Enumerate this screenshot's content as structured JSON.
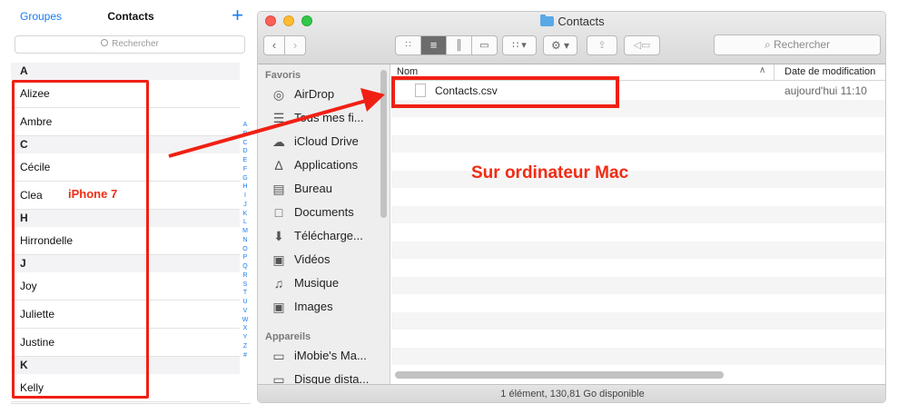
{
  "iphone": {
    "nav": {
      "left": "Groupes",
      "title": "Contacts",
      "add": "+"
    },
    "search_placeholder": "Rechercher",
    "rows": [
      {
        "kind": "hdr",
        "text": "A"
      },
      {
        "kind": "c",
        "text": "Alizee"
      },
      {
        "kind": "c",
        "text": "Ambre"
      },
      {
        "kind": "hdr",
        "text": "C"
      },
      {
        "kind": "c",
        "text": "Cécile"
      },
      {
        "kind": "c",
        "text": "Clea"
      },
      {
        "kind": "hdr",
        "text": "H"
      },
      {
        "kind": "c",
        "text": "Hirrondelle"
      },
      {
        "kind": "hdr",
        "text": "J"
      },
      {
        "kind": "c",
        "text": "Joy"
      },
      {
        "kind": "c",
        "text": "Juliette"
      },
      {
        "kind": "c",
        "text": "Justine"
      },
      {
        "kind": "hdr",
        "text": "K"
      },
      {
        "kind": "c",
        "text": "Kelly"
      }
    ],
    "index_letters": [
      "A",
      "B",
      "C",
      "D",
      "E",
      "F",
      "G",
      "H",
      "I",
      "J",
      "K",
      "L",
      "M",
      "N",
      "O",
      "P",
      "Q",
      "R",
      "S",
      "T",
      "U",
      "V",
      "W",
      "X",
      "Y",
      "Z",
      "#"
    ]
  },
  "annotations": {
    "iphone_label": "iPhone 7",
    "mac_label": "Sur ordinateur Mac",
    "accent_color": "#f02014"
  },
  "finder": {
    "title": "Contacts",
    "search_placeholder": "Rechercher",
    "sidebar": {
      "favorites_header": "Favoris",
      "favorites": [
        {
          "icon": "airdrop-icon",
          "label": "AirDrop"
        },
        {
          "icon": "all-files-icon",
          "label": "Tous mes fi..."
        },
        {
          "icon": "icloud-drive-icon",
          "label": "iCloud Drive"
        },
        {
          "icon": "applications-icon",
          "label": "Applications"
        },
        {
          "icon": "desktop-icon",
          "label": "Bureau"
        },
        {
          "icon": "documents-icon",
          "label": "Documents"
        },
        {
          "icon": "downloads-icon",
          "label": "Télécharge..."
        },
        {
          "icon": "movies-icon",
          "label": "Vidéos"
        },
        {
          "icon": "music-icon",
          "label": "Musique"
        },
        {
          "icon": "pictures-icon",
          "label": "Images"
        }
      ],
      "devices_header": "Appareils",
      "devices": [
        {
          "icon": "computer-icon",
          "label": "iMobie's Ma..."
        },
        {
          "icon": "disk-icon",
          "label": "Disque dista..."
        }
      ]
    },
    "columns": {
      "name": "Nom",
      "date": "Date de modification"
    },
    "files": [
      {
        "name": "Contacts.csv",
        "date": "aujourd'hui 11:10"
      }
    ],
    "status": "1 élément, 130,81 Go disponible"
  }
}
